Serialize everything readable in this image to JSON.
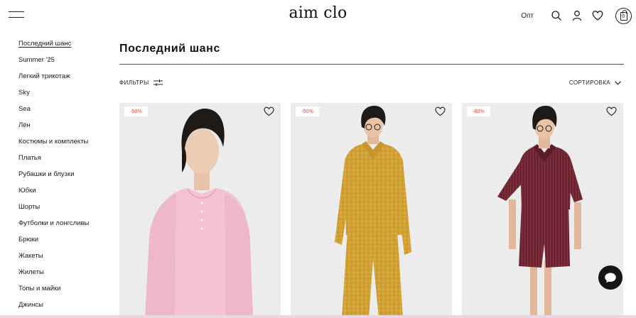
{
  "header": {
    "logo": "aim clo",
    "opt_label": "Опт",
    "cart_count": "0"
  },
  "sidebar": {
    "items": [
      {
        "label": "Последний шанс",
        "active": true
      },
      {
        "label": "Summer '25"
      },
      {
        "label": "Легкий трикотаж"
      },
      {
        "label": "Sky"
      },
      {
        "label": "Sea"
      },
      {
        "label": "Лён"
      },
      {
        "label": "Костюмы и комплекты"
      },
      {
        "label": "Платья"
      },
      {
        "label": "Рубашки и блузки"
      },
      {
        "label": "Юбки"
      },
      {
        "label": "Шорты"
      },
      {
        "label": "Футболки и лонгсливы"
      },
      {
        "label": "Брюки"
      },
      {
        "label": "Жакеты"
      },
      {
        "label": "Жилеты"
      },
      {
        "label": "Топы и майки"
      },
      {
        "label": "Джинсы"
      }
    ]
  },
  "main": {
    "title": "Последний шанс",
    "filters_label": "ФИЛЬТРЫ",
    "sort_label": "СОРТИРОВКА"
  },
  "products": [
    {
      "badge": "-50%",
      "garment_color": "#f3c3d3"
    },
    {
      "badge": "-50%",
      "garment_color": "#d9aa3c"
    },
    {
      "badge": "-60%",
      "garment_color": "#6b2430"
    }
  ],
  "colors": {
    "badge_text": "#e04343",
    "card_background": "#ececec",
    "chat_button": "#161616"
  }
}
